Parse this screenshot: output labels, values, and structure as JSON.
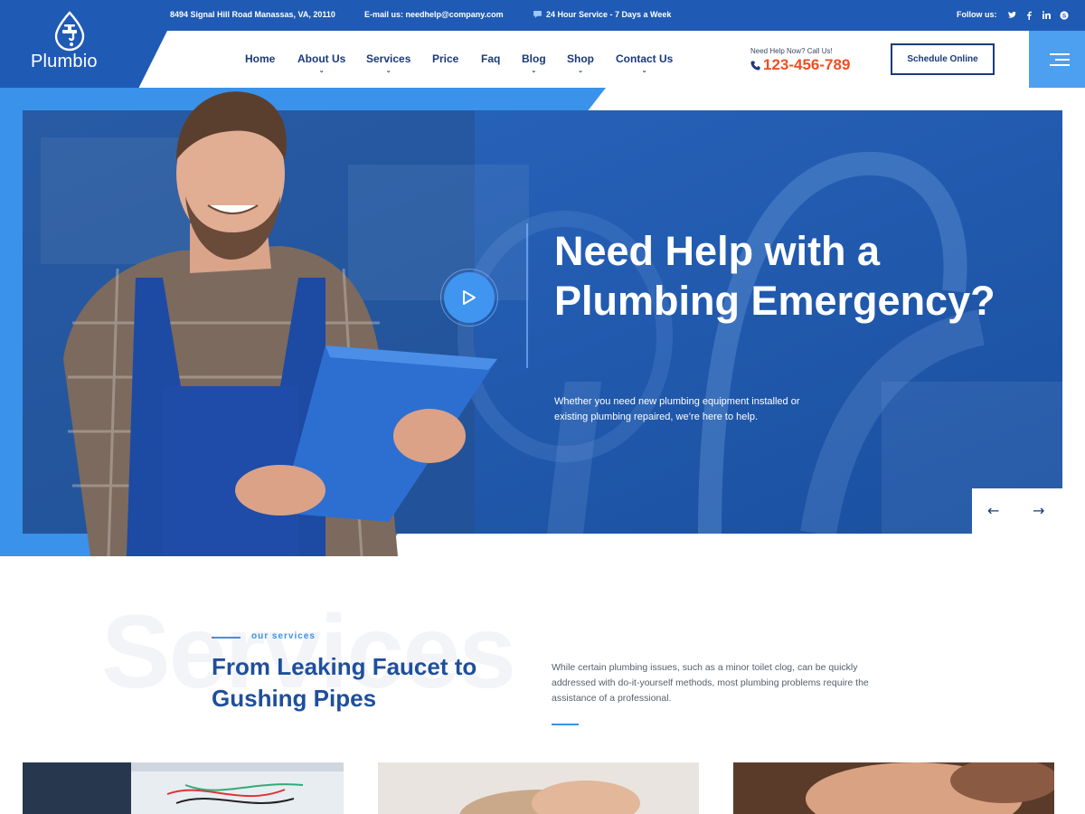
{
  "topbar": {
    "address": "8494 Signal Hill Road Manassas, VA, 20110",
    "email": "E-mail us: needhelp@company.com",
    "service": "24 Hour Service - 7 Days a Week",
    "follow_label": "Follow us:",
    "socials": [
      "twitter-icon",
      "facebook-icon",
      "linkedin-icon",
      "skype-icon"
    ]
  },
  "brand": {
    "name": "Plumbio"
  },
  "nav": {
    "items": [
      {
        "label": "Home",
        "has_dropdown": false
      },
      {
        "label": "About Us",
        "has_dropdown": true
      },
      {
        "label": "Services",
        "has_dropdown": true
      },
      {
        "label": "Price",
        "has_dropdown": false
      },
      {
        "label": "Faq",
        "has_dropdown": false
      },
      {
        "label": "Blog",
        "has_dropdown": true
      },
      {
        "label": "Shop",
        "has_dropdown": true
      },
      {
        "label": "Contact Us",
        "has_dropdown": true
      }
    ]
  },
  "header": {
    "help_label": "Need Help Now? Call Us!",
    "phone": "123-456-789",
    "schedule_label": "Schedule Online"
  },
  "hero": {
    "title": "Need Help with a Plumbing Emergency?",
    "subtitle": "Whether you need new plumbing equipment installed or existing plumbing repaired, we’re here to help.",
    "prev_arrow": "←",
    "next_arrow": "→"
  },
  "services": {
    "ghost_text": "Services",
    "kicker": "our services",
    "title": "From Leaking Faucet to Gushing Pipes",
    "description": "While certain plumbing issues, such as a minor toilet clog, can be quickly addressed with do-it-yourself methods, most plumbing problems require the assistance of a professional."
  },
  "colors": {
    "primary_dark": "#1f5ab4",
    "accent_blue": "#3a92ea",
    "nav_text": "#1a3a7a",
    "phone_orange": "#f04e23"
  }
}
